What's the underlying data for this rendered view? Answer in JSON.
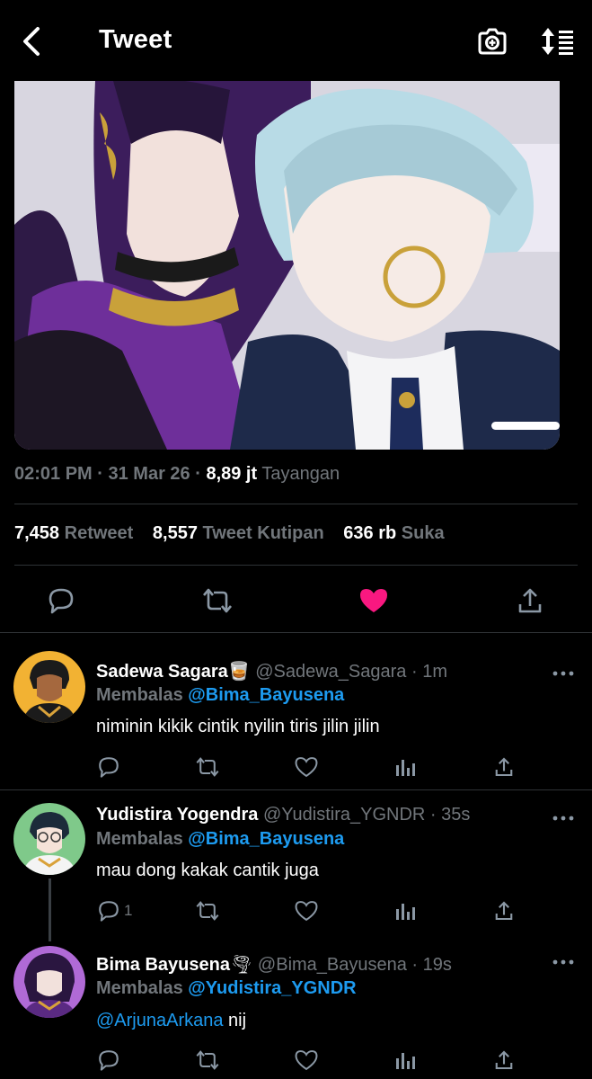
{
  "header": {
    "title": "Tweet"
  },
  "tweet": {
    "time": "02:01 PM",
    "sep1": " · ",
    "date": "31 Mar 26",
    "sep2": " · ",
    "views_count": "8,89 jt",
    "views_label": "Tayangan",
    "retweets_count": "7,458",
    "retweets_label": "Retweet",
    "quotes_count": "8,557",
    "quotes_label": "Tweet Kutipan",
    "likes_count": "636 rb",
    "likes_label": "Suka",
    "liked": true
  },
  "replies": [
    {
      "name": "Sadewa Sagara",
      "emoji": "🥃",
      "handle": "@Sadewa_Sagara",
      "time": " · 1m",
      "replying_label": "Membalas ",
      "replying_to": "@Bima_Bayusena",
      "text": "niminin kikik cintik nyilin tiris jilin jilin",
      "reply_count": ""
    },
    {
      "name": "Yudistira Yogendra",
      "emoji": "",
      "handle": "@Yudistira_YGNDR",
      "time": " · 35s",
      "replying_label": "Membalas ",
      "replying_to": "@Bima_Bayusena",
      "text": "mau dong kakak cantik juga",
      "reply_count": "1"
    },
    {
      "name": "Bima Bayusena",
      "emoji": "🌪",
      "handle": "@Bima_Bayusena",
      "time": " · 19s",
      "replying_label": "Membalas ",
      "replying_to": "@Yudistira_YGNDR",
      "text_mention": "@ArjunaArkana",
      "text": " nij",
      "reply_count": ""
    }
  ],
  "colors": {
    "background": "#000000",
    "accent": "#1d9bf0",
    "like": "#f91880",
    "muted": "#71767b"
  },
  "icons": [
    "back-arrow-icon",
    "camera-plus-icon",
    "sort-icon",
    "reply-icon",
    "retweet-icon",
    "heart-icon",
    "share-icon",
    "analytics-icon",
    "more-icon"
  ]
}
